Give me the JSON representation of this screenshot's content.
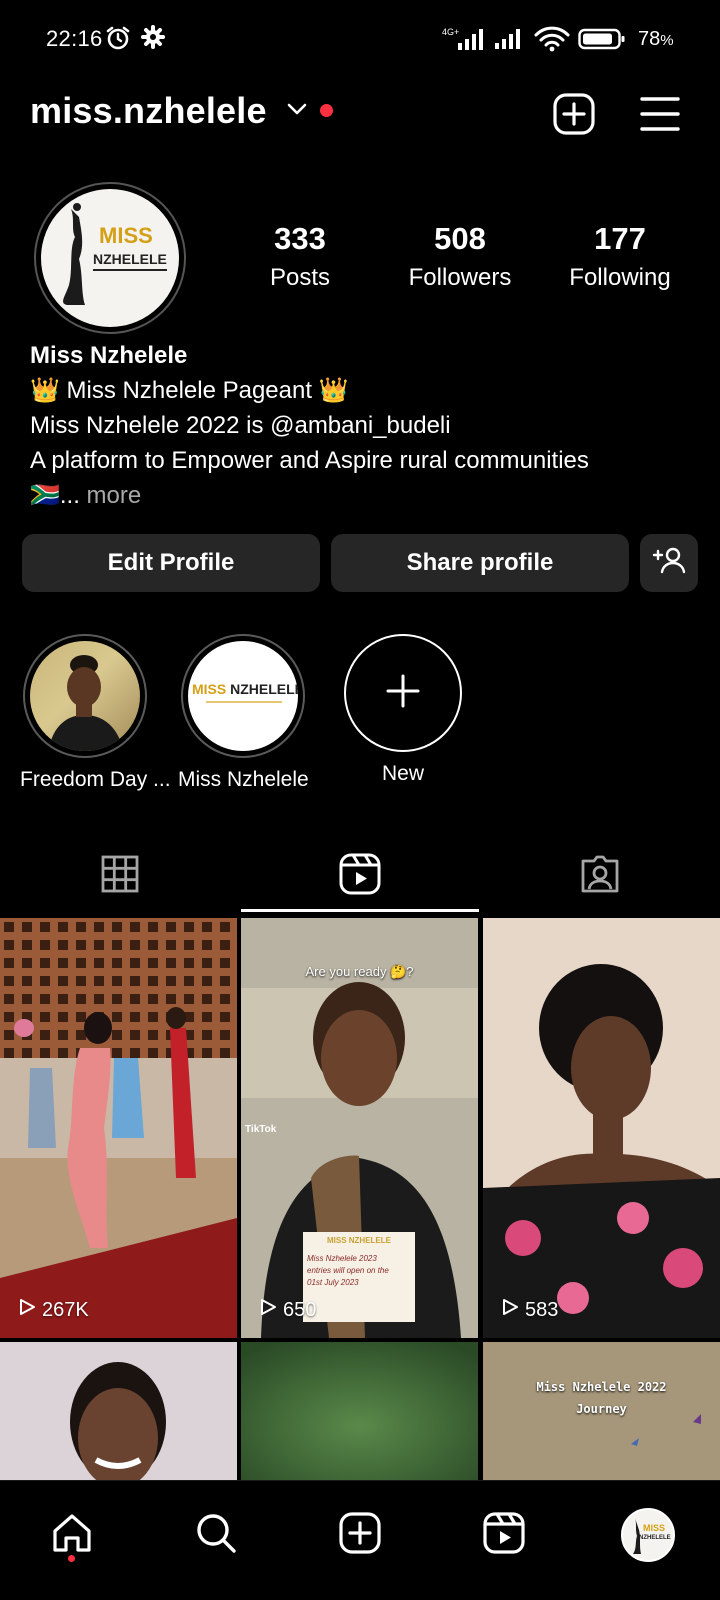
{
  "status_bar": {
    "time": "22:16",
    "battery_percent": "78",
    "battery_suffix": "%",
    "network_label": "4G+",
    "icons": [
      "alarm-icon",
      "gear-icon",
      "signal-icon",
      "signal-icon",
      "wifi-icon",
      "battery-icon"
    ]
  },
  "header": {
    "username": "miss.nzhelele",
    "icons": [
      "chevron-down-icon",
      "notification-dot",
      "create-plus-icon",
      "menu-icon"
    ]
  },
  "profile": {
    "avatar_text_1": "MISS",
    "avatar_text_2": "NZHELELE",
    "stats": [
      {
        "value": "333",
        "label": "Posts"
      },
      {
        "value": "508",
        "label": "Followers"
      },
      {
        "value": "177",
        "label": "Following"
      }
    ],
    "display_name": "Miss Nzhelele",
    "bio_lines": [
      "👑 Miss Nzhelele Pageant 👑",
      "Miss Nzhelele 2022 is @ambani_budeli",
      "A platform to Empower and Aspire rural communities"
    ],
    "bio_ellipsis": "🇿🇦...",
    "bio_more": " more"
  },
  "actions": {
    "edit_label": "Edit Profile",
    "share_label": "Share profile",
    "add_icon": "add-person-icon"
  },
  "highlights": [
    {
      "label": "Freedom Day ..."
    },
    {
      "label": "Miss Nzhelele",
      "logo_1": "MISS",
      "logo_2": "NZHELELE"
    },
    {
      "label": "New"
    }
  ],
  "tabs": [
    {
      "icon": "grid-icon",
      "active": false
    },
    {
      "icon": "reels-icon",
      "active": true
    },
    {
      "icon": "tagged-icon",
      "active": false
    }
  ],
  "posts": [
    {
      "views": "267K"
    },
    {
      "views": "650",
      "caption": "Are you ready 🤔?",
      "watermark": "TikTok",
      "card_title": "MISS NZHELELE",
      "card_lines": [
        "Miss Nzhelele 2023",
        "entries will open on the",
        "01st July 2023"
      ]
    },
    {
      "views": "583"
    },
    {
      "views": ""
    },
    {
      "views": ""
    },
    {
      "views": "",
      "caption_1": "Miss Nzhelele 2022",
      "caption_2": "Journey"
    }
  ],
  "bottom_nav": [
    "home-icon",
    "search-icon",
    "create-icon",
    "reels-icon",
    "profile-avatar"
  ],
  "colors": {
    "background": "#000000",
    "button": "#262626",
    "accent_red": "#ff3040",
    "logo_gold": "#d4a017"
  }
}
